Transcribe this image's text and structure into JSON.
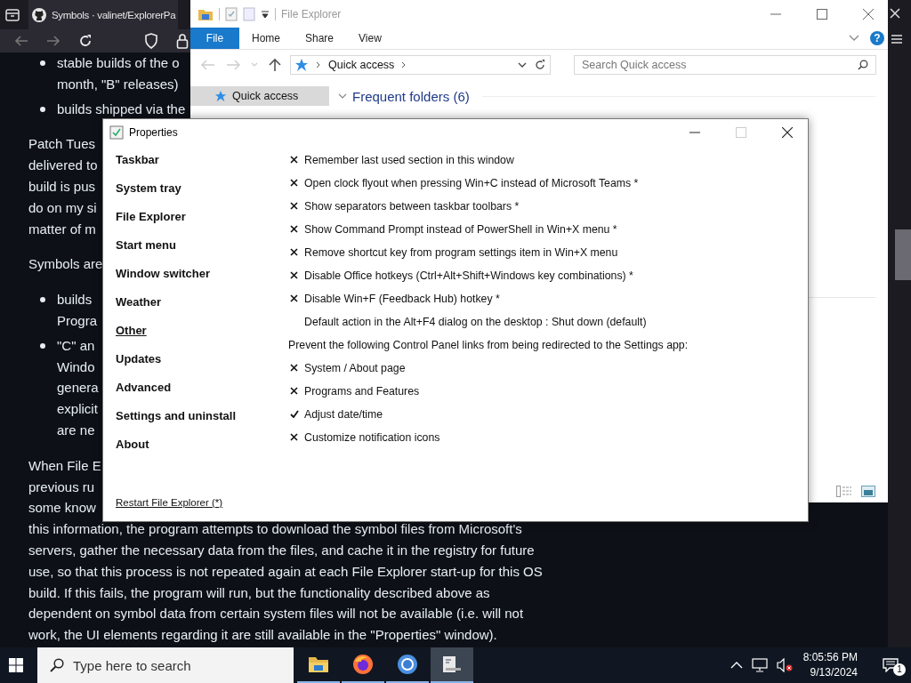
{
  "browser": {
    "tab_title": "Symbols · valinet/ExplorerPa"
  },
  "article": {
    "blocks": [
      {
        "kind": "bullet",
        "lines": [
          "stable builds of the o",
          "month, \"B\" releases)"
        ]
      },
      {
        "kind": "bullet",
        "lines": [
          "builds shipped via the"
        ]
      },
      {
        "kind": "paragraph",
        "lines": [
          "Patch Tues",
          "delivered to",
          "build is pus",
          "do on my si",
          "matter of m"
        ]
      },
      {
        "kind": "paragraph",
        "lines": [
          "Symbols are"
        ]
      },
      {
        "kind": "bullet",
        "lines": [
          "builds",
          "Progra"
        ]
      },
      {
        "kind": "bullet",
        "lines": [
          "\"C\" an",
          "Windo",
          "genera",
          "explicit",
          "are ne"
        ]
      },
      {
        "kind": "paragraph",
        "lines": [
          "When File E",
          "previous ru",
          "some know",
          "this information, the program attempts to download the symbol files from Microsoft's",
          "servers, gather the necessary data from the files, and cache it in the registry for future",
          "use, so that this process is not repeated again at each File Explorer start-up for this OS",
          "build. If this fails, the program will run, but the functionality described above as",
          "dependent on symbol data from certain system files will not be available (i.e. will not",
          "work, the UI elements regarding it are still available in the \"Properties\" window)."
        ]
      }
    ]
  },
  "file_explorer": {
    "title": "File Explorer",
    "file_button": "File",
    "ribbon_tabs": [
      {
        "label": "Home",
        "selected": false
      },
      {
        "label": "Share",
        "selected": false
      },
      {
        "label": "View",
        "selected": false
      }
    ],
    "help": "?",
    "address": "Quick access",
    "search": {
      "placeholder": "Search Quick access"
    },
    "nav_items": [
      {
        "label": "Quick access",
        "selected": true
      }
    ],
    "section": "Frequent folders (6)"
  },
  "properties": {
    "title": "Properties",
    "nav": [
      {
        "label": "Taskbar",
        "selected": false
      },
      {
        "label": "System tray",
        "selected": false
      },
      {
        "label": "File Explorer",
        "selected": false
      },
      {
        "label": "Start menu",
        "selected": false
      },
      {
        "label": "Window switcher",
        "selected": false
      },
      {
        "label": "Weather",
        "selected": false
      },
      {
        "label": "Other",
        "selected": true
      },
      {
        "label": "Updates",
        "selected": false
      },
      {
        "label": "Advanced",
        "selected": false
      },
      {
        "label": "Settings and uninstall",
        "selected": false
      },
      {
        "label": "About",
        "selected": false
      }
    ],
    "options": [
      {
        "kind": "checkbox",
        "label": "Remember last used section in this window",
        "checked": false
      },
      {
        "kind": "checkbox",
        "label": "Open clock flyout when pressing Win+C instead of Microsoft Teams *",
        "checked": false
      },
      {
        "kind": "checkbox",
        "label": "Show separators between taskbar toolbars *",
        "checked": false
      },
      {
        "kind": "checkbox",
        "label": "Show Command Prompt instead of PowerShell in Win+X menu *",
        "checked": false
      },
      {
        "kind": "checkbox",
        "label": "Remove shortcut key from program settings item in Win+X menu",
        "checked": false
      },
      {
        "kind": "checkbox",
        "label": "Disable Office hotkeys (Ctrl+Alt+Shift+Windows key combinations) *",
        "checked": false
      },
      {
        "kind": "checkbox",
        "label": "Disable Win+F (Feedback Hub) hotkey *",
        "checked": false
      },
      {
        "kind": "choice",
        "label": "Default action in the Alt+F4 dialog on the desktop : Shut down (default)"
      },
      {
        "kind": "heading",
        "label": "Prevent the following Control Panel links from being redirected to the Settings app:"
      },
      {
        "kind": "checkbox",
        "label": "System / About page",
        "checked": false
      },
      {
        "kind": "checkbox",
        "label": "Programs and Features",
        "checked": false
      },
      {
        "kind": "checkbox",
        "label": "Adjust date/time",
        "checked": true
      },
      {
        "kind": "checkbox",
        "label": "Customize notification icons",
        "checked": false
      }
    ],
    "restart_link": "Restart File Explorer (*)"
  },
  "taskbar": {
    "search_placeholder": "Type here to search",
    "apps": [
      {
        "kind": "folder",
        "selected": false
      },
      {
        "kind": "firefox",
        "selected": false
      },
      {
        "kind": "chrome",
        "selected": false
      },
      {
        "kind": "terminal",
        "selected": true
      }
    ],
    "time": "8:05:56 PM",
    "date": "9/13/2024",
    "notification_count": "1"
  }
}
